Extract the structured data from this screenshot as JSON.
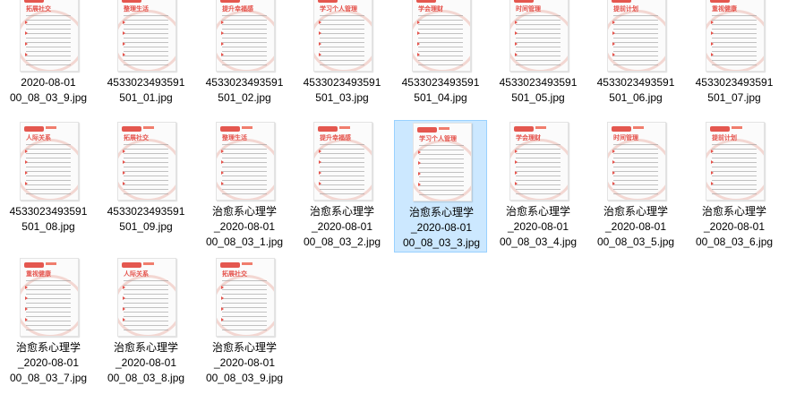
{
  "files": [
    {
      "name_lines": [
        "2020-08-01",
        "00_08_03_9.jpg"
      ],
      "thumb_title": "拓展社交",
      "selected": false
    },
    {
      "name_lines": [
        "4533023493591",
        "501_01.jpg"
      ],
      "thumb_title": "整理生活",
      "selected": false
    },
    {
      "name_lines": [
        "4533023493591",
        "501_02.jpg"
      ],
      "thumb_title": "提升幸福感",
      "selected": false
    },
    {
      "name_lines": [
        "4533023493591",
        "501_03.jpg"
      ],
      "thumb_title": "学习个人管理",
      "selected": false
    },
    {
      "name_lines": [
        "4533023493591",
        "501_04.jpg"
      ],
      "thumb_title": "学会理财",
      "selected": false
    },
    {
      "name_lines": [
        "4533023493591",
        "501_05.jpg"
      ],
      "thumb_title": "时间管理",
      "selected": false
    },
    {
      "name_lines": [
        "4533023493591",
        "501_06.jpg"
      ],
      "thumb_title": "提前计划",
      "selected": false
    },
    {
      "name_lines": [
        "4533023493591",
        "501_07.jpg"
      ],
      "thumb_title": "重视健康",
      "selected": false
    },
    {
      "name_lines": [
        "4533023493591",
        "501_08.jpg"
      ],
      "thumb_title": "人际关系",
      "selected": false
    },
    {
      "name_lines": [
        "4533023493591",
        "501_09.jpg"
      ],
      "thumb_title": "拓展社交",
      "selected": false
    },
    {
      "name_lines": [
        "治愈系心理学",
        "_2020-08-01",
        "00_08_03_1.jpg"
      ],
      "thumb_title": "整理生活",
      "selected": false
    },
    {
      "name_lines": [
        "治愈系心理学",
        "_2020-08-01",
        "00_08_03_2.jpg"
      ],
      "thumb_title": "提升幸福感",
      "selected": false
    },
    {
      "name_lines": [
        "治愈系心理学",
        "_2020-08-01",
        "00_08_03_3.jpg"
      ],
      "thumb_title": "学习个人管理",
      "selected": true
    },
    {
      "name_lines": [
        "治愈系心理学",
        "_2020-08-01",
        "00_08_03_4.jpg"
      ],
      "thumb_title": "学会理财",
      "selected": false
    },
    {
      "name_lines": [
        "治愈系心理学",
        "_2020-08-01",
        "00_08_03_5.jpg"
      ],
      "thumb_title": "时间管理",
      "selected": false
    },
    {
      "name_lines": [
        "治愈系心理学",
        "_2020-08-01",
        "00_08_03_6.jpg"
      ],
      "thumb_title": "提前计划",
      "selected": false
    },
    {
      "name_lines": [
        "治愈系心理学",
        "_2020-08-01",
        "00_08_03_7.jpg"
      ],
      "thumb_title": "重视健康",
      "selected": false
    },
    {
      "name_lines": [
        "治愈系心理学",
        "_2020-08-01",
        "00_08_03_8.jpg"
      ],
      "thumb_title": "人际关系",
      "selected": false
    },
    {
      "name_lines": [
        "治愈系心理学",
        "_2020-08-01",
        "00_08_03_9.jpg"
      ],
      "thumb_title": "拓展社交",
      "selected": false
    }
  ],
  "colors": {
    "accent": "#e5524b",
    "selection_bg": "#cce8ff",
    "selection_border": "#99d1ff"
  }
}
